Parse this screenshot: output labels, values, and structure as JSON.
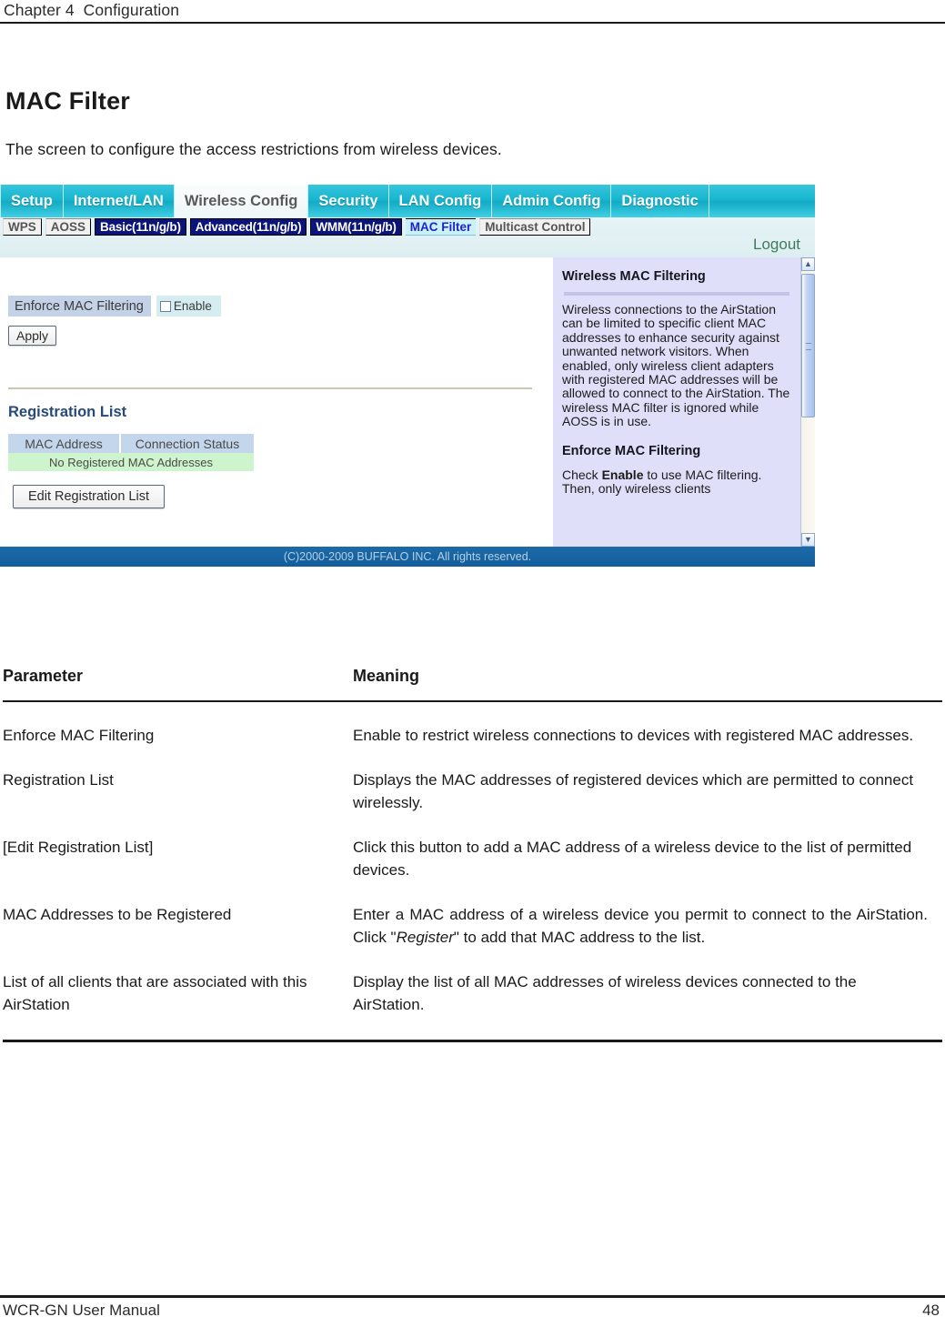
{
  "page": {
    "running_header": "Chapter 4  Configuration",
    "title": "MAC Filter",
    "intro": "The screen to configure the access restrictions from wireless devices.",
    "footer_left": "WCR-GN User Manual",
    "footer_page": "48"
  },
  "screenshot": {
    "main_nav": [
      {
        "label": "Setup",
        "active": false
      },
      {
        "label": "Internet/LAN",
        "active": false
      },
      {
        "label": "Wireless Config",
        "active": true
      },
      {
        "label": "Security",
        "active": false
      },
      {
        "label": "LAN Config",
        "active": false
      },
      {
        "label": "Admin Config",
        "active": false
      },
      {
        "label": "Diagnostic",
        "active": false
      }
    ],
    "sub_nav": [
      {
        "label": "WPS",
        "style": "plain"
      },
      {
        "label": "AOSS",
        "style": "plain"
      },
      {
        "label": "Basic(11n/g/b)",
        "style": "navy"
      },
      {
        "label": "Advanced(11n/g/b)",
        "style": "navy"
      },
      {
        "label": "WMM(11n/g/b)",
        "style": "navy"
      },
      {
        "label": "MAC Filter",
        "style": "cyan"
      },
      {
        "label": "Multicast Control",
        "style": "plain"
      }
    ],
    "logout_label": "Logout",
    "form": {
      "enforce_label": "Enforce MAC Filtering",
      "enable_label": "Enable",
      "enable_checked": false,
      "apply_label": "Apply"
    },
    "registration": {
      "section_title": "Registration List",
      "columns": [
        "MAC Address",
        "Connection Status"
      ],
      "empty_text": "No Registered MAC Addresses",
      "edit_button_label": "Edit Registration List"
    },
    "help": {
      "heading": "Wireless MAC Filtering",
      "body": "Wireless connections to the AirStation can be limited to specific client MAC addresses to enhance security against unwanted network visitors. When enabled, only wireless client adapters with registered MAC addresses will be allowed to connect to the AirStation. The wireless MAC filter is ignored while AOSS is in use.",
      "heading2": "Enforce MAC Filtering",
      "body2_prefix": "Check ",
      "body2_bold": "Enable",
      "body2_suffix": " to use MAC filtering. Then, only wireless clients"
    },
    "copyright": "(C)2000-2009 BUFFALO INC. All rights reserved.",
    "colors": {
      "nav_cyan": "#16b4ce",
      "sub_navy": "#0b1478",
      "active_tab_text": "#2222cc",
      "help_panel_bg": "#dfdffa",
      "footer_blue": "#125e9c",
      "empty_row_green": "#cdf4cd",
      "table_header_blue": "#c3d6ec"
    }
  },
  "param_table": {
    "headers": {
      "parameter": "Parameter",
      "meaning": "Meaning"
    },
    "rows": [
      {
        "parameter": "Enforce MAC Filtering",
        "meaning": "Enable to restrict wireless connections to devices with registered MAC addresses."
      },
      {
        "parameter": "Registration List",
        "meaning": "Displays the MAC addresses of registered devices which are permitted to connect wirelessly."
      },
      {
        "parameter": "[Edit Registration List]",
        "meaning": "Click this button to add a MAC address of a wireless device to the list of permitted devices."
      },
      {
        "parameter": "MAC Addresses to be Registered",
        "meaning_pre": "Enter a MAC address of a wireless device you permit to connect to the AirStation. Click \"",
        "meaning_em": "Register",
        "meaning_post": "\" to add that MAC address to the list."
      },
      {
        "parameter": "List of all clients that are associated with this AirStation",
        "meaning": "Display the list of all MAC addresses of wireless devices connected to the AirStation."
      }
    ]
  }
}
